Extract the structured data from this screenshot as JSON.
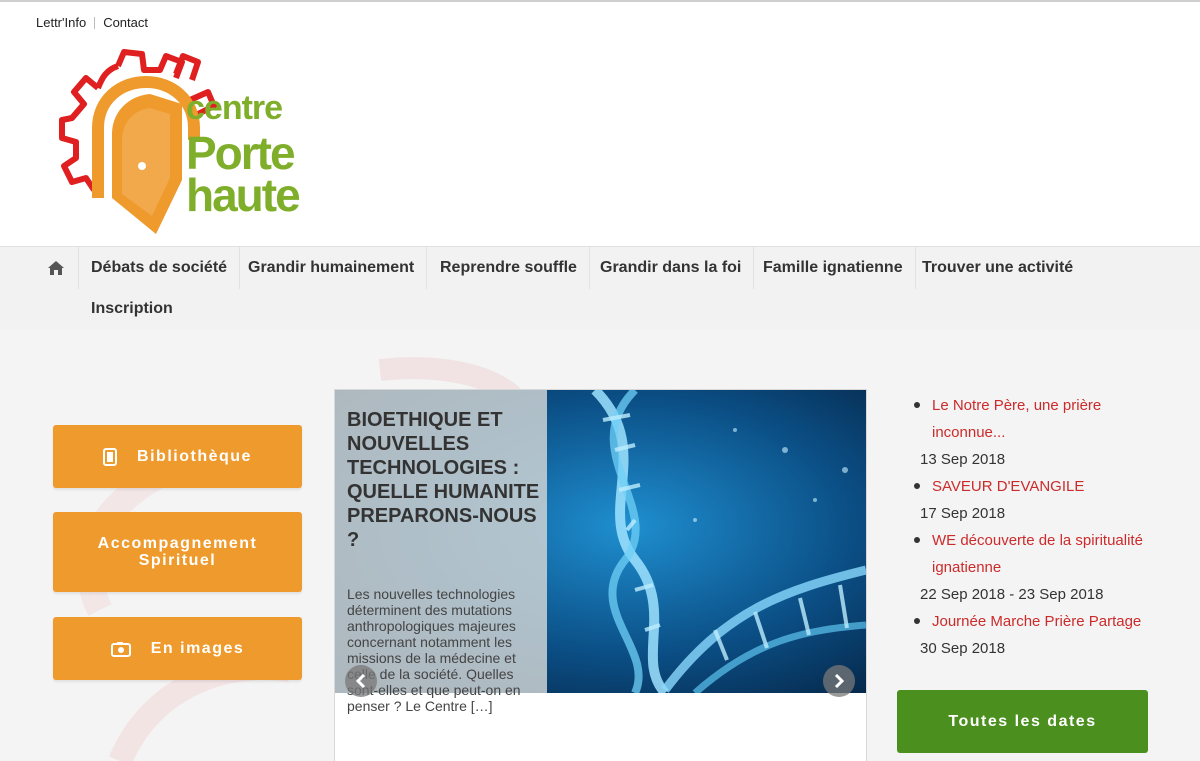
{
  "toplinks": {
    "newsletter": "Lettr'Info",
    "contact": "Contact"
  },
  "logo": {
    "line1": "centre",
    "line2": "Porte",
    "line3": "haute"
  },
  "nav": {
    "home_icon": "home-icon",
    "items": [
      "Débats de société",
      "Grandir humainement",
      "Reprendre souffle",
      "Grandir dans la foi",
      "Famille ignatienne",
      "Trouver une activité",
      "Inscription"
    ]
  },
  "sidebar": {
    "buttons": [
      {
        "label": "Bibliothèque",
        "icon": "book-icon"
      },
      {
        "label": "Accompagnement Spirituel",
        "icon": ""
      },
      {
        "label": "En images",
        "icon": "photo-icon"
      }
    ]
  },
  "slider": {
    "title": "BIOETHIQUE ET NOUVELLES TECHNOLOGIES : QUELLE HUMANITE PREPARONS-NOUS ?",
    "excerpt": "Les nouvelles technologies déterminent des mutations anthropologiques majeures concernant notamment les missions de la médecine et celle de la société. Quelles sont-elles et que peut-on en penser ? Le Centre […]",
    "prev_icon": "chevron-left-icon",
    "next_icon": "chevron-right-icon"
  },
  "events": [
    {
      "title": "Le Notre Père, une prière inconnue...",
      "date": "13 Sep 2018"
    },
    {
      "title": "SAVEUR D'EVANGILE",
      "date": "17 Sep 2018"
    },
    {
      "title": "WE découverte de la spiritualité ignatienne",
      "date": "22 Sep 2018 - 23 Sep 2018"
    },
    {
      "title": "Journée Marche Prière Partage",
      "date": "30 Sep 2018"
    }
  ],
  "all_dates_label": "Toutes les dates",
  "colors": {
    "orange": "#ef9a2c",
    "green": "#4b8f1f",
    "event_red": "#cc2b2b",
    "logo_green": "#7fae2a",
    "logo_red": "#e02020"
  }
}
